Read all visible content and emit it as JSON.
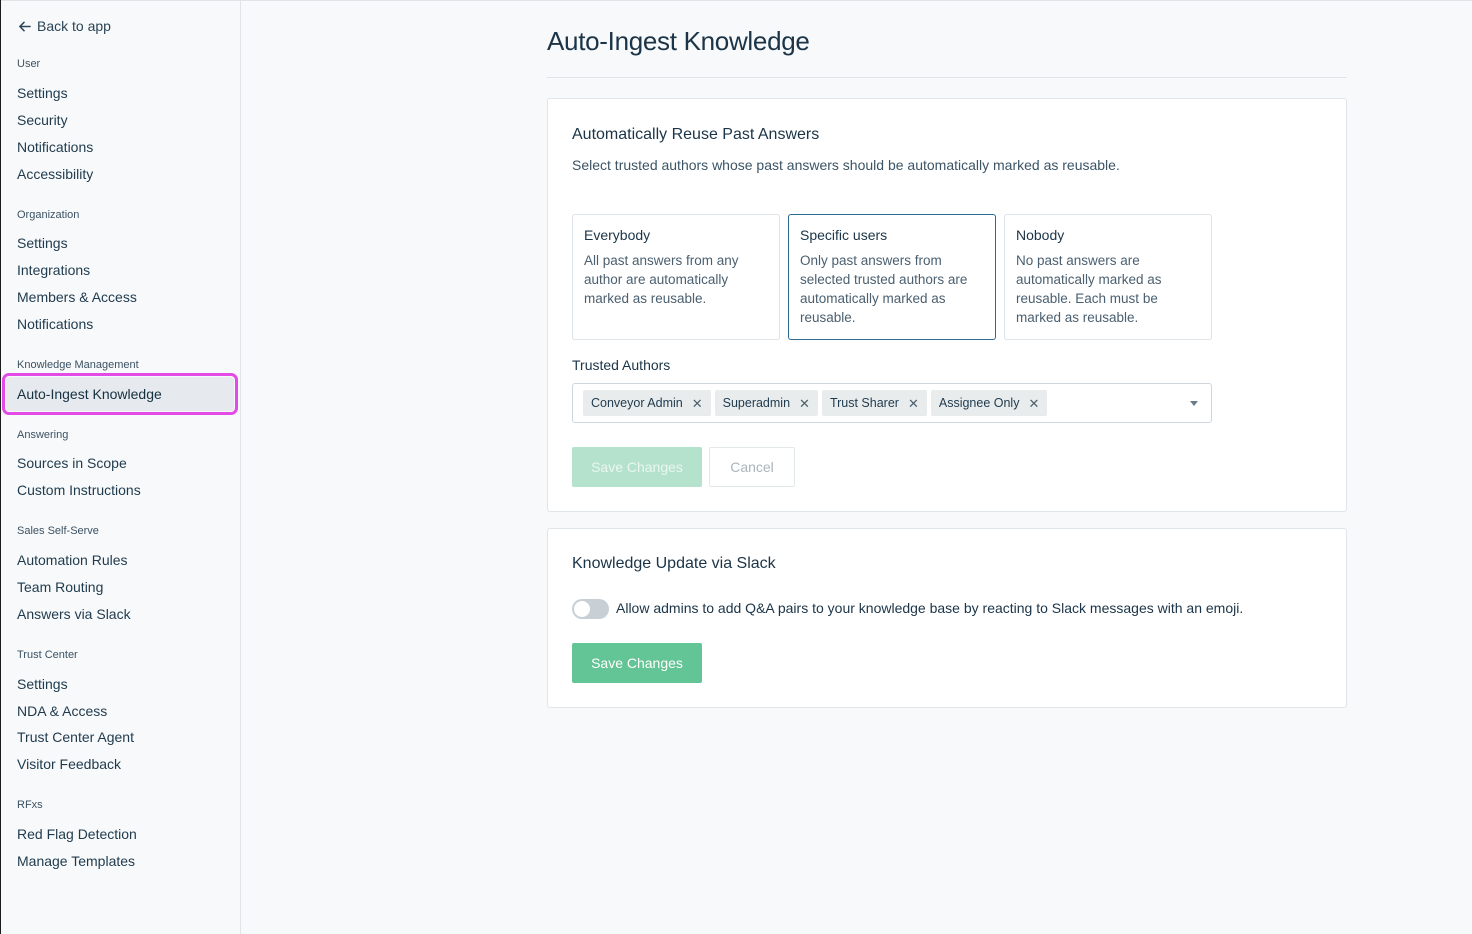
{
  "sidebar": {
    "back_label": "Back to app",
    "groups": [
      {
        "label": "User",
        "items": [
          "Settings",
          "Security",
          "Notifications",
          "Accessibility"
        ]
      },
      {
        "label": "Organization",
        "items": [
          "Settings",
          "Integrations",
          "Members & Access",
          "Notifications"
        ]
      },
      {
        "label": "Knowledge Management",
        "items": [
          "Auto-Ingest Knowledge"
        ]
      },
      {
        "label": "Answering",
        "items": [
          "Sources in Scope",
          "Custom Instructions"
        ]
      },
      {
        "label": "Sales Self-Serve",
        "items": [
          "Automation Rules",
          "Team Routing",
          "Answers via Slack"
        ]
      },
      {
        "label": "Trust Center",
        "items": [
          "Settings",
          "NDA & Access",
          "Trust Center Agent",
          "Visitor Feedback"
        ]
      },
      {
        "label": "RFxs",
        "items": [
          "Red Flag Detection",
          "Manage Templates"
        ]
      }
    ],
    "active_item": "Auto-Ingest Knowledge"
  },
  "main": {
    "title": "Auto-Ingest Knowledge",
    "reuse_card": {
      "title": "Automatically Reuse Past Answers",
      "description": "Select trusted authors whose past answers should be automatically marked as reusable.",
      "options": [
        {
          "title": "Everybody",
          "description": "All past answers from any author are automatically marked as reusable.",
          "selected": false
        },
        {
          "title": "Specific users",
          "description": "Only past answers from selected trusted authors are automatically marked as reusable.",
          "selected": true
        },
        {
          "title": "Nobody",
          "description": "No past answers are automatically marked as reusable. Each must be marked as reusable.",
          "selected": false
        }
      ],
      "trusted_authors_label": "Trusted Authors",
      "trusted_authors": [
        "Conveyor Admin",
        "Superadmin",
        "Trust Sharer",
        "Assignee Only"
      ],
      "save_label": "Save Changes",
      "cancel_label": "Cancel"
    },
    "slack_card": {
      "title": "Knowledge Update via Slack",
      "toggle_label": "Allow admins to add Q&A pairs to your knowledge base by reacting to Slack messages with an emoji.",
      "toggle_on": false,
      "save_label": "Save Changes"
    }
  },
  "colors": {
    "accent_green": "#63c495",
    "accent_green_disabled": "#b4e2cc",
    "selected_border": "#2f6a92",
    "highlight_outline": "#e24be6"
  }
}
